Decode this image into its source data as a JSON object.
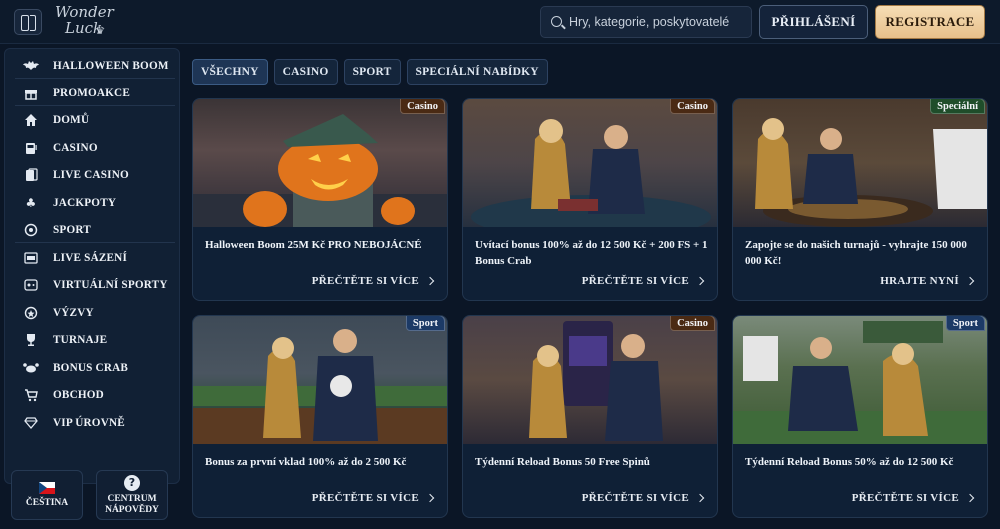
{
  "header": {
    "logo_text_1": "Wonder",
    "logo_text_2": "Luck",
    "search_placeholder": "Hry, kategorie, poskytovatelé",
    "login_label": "PŘIHLÁŠENÍ",
    "register_label": "REGISTRACE"
  },
  "sidebar": {
    "items": [
      {
        "label": "HALLOWEEN BOOM",
        "icon": "bat-icon"
      },
      {
        "label": "PROMOAKCE",
        "icon": "gift-icon"
      },
      {
        "label": "DOMŮ",
        "icon": "home-icon"
      },
      {
        "label": "CASINO",
        "icon": "slot-machine-icon"
      },
      {
        "label": "LIVE CASINO",
        "icon": "cards-icon"
      },
      {
        "label": "JACKPOTY",
        "icon": "clover-icon"
      },
      {
        "label": "SPORT",
        "icon": "ball-icon"
      },
      {
        "label": "LIVE SÁZENÍ",
        "icon": "live-icon"
      },
      {
        "label": "VIRTUÁLNÍ SPORTY",
        "icon": "controller-icon"
      },
      {
        "label": "VÝZVY",
        "icon": "badge-icon"
      },
      {
        "label": "TURNAJE",
        "icon": "trophy-icon"
      },
      {
        "label": "BONUS CRAB",
        "icon": "crab-icon"
      },
      {
        "label": "OBCHOD",
        "icon": "cart-icon"
      },
      {
        "label": "VIP ÚROVNĚ",
        "icon": "diamond-icon"
      }
    ],
    "language_label": "ČEŠTINA",
    "help_label_1": "CENTRUM",
    "help_label_2": "NÁPOVĚDY"
  },
  "tabs": [
    {
      "label": "VŠECHNY",
      "active": true
    },
    {
      "label": "CASINO",
      "active": false
    },
    {
      "label": "SPORT",
      "active": false
    },
    {
      "label": "SPECIÁLNÍ NABÍDKY",
      "active": false
    }
  ],
  "cards": [
    {
      "badge": "Casino",
      "badge_color": "#4a2a14",
      "title": "Halloween Boom 25M Kč PRO NEBOJÁCNÉ",
      "action": "PŘEČTĚTE SI VÍCE"
    },
    {
      "badge": "Casino",
      "badge_color": "#4a2a14",
      "title": "Uvítací bonus 100% až do 12 500 Kč + 200 FS + 1 Bonus Crab",
      "action": "PŘEČTĚTE SI VÍCE"
    },
    {
      "badge": "Speciální",
      "badge_color": "#1f4d2a",
      "title": "Zapojte se do našich turnajů - vyhrajte 150 000 000 Kč!",
      "action": "HRAJTE NYNÍ"
    },
    {
      "badge": "Sport",
      "badge_color": "#1c3a66",
      "title": "Bonus za první vklad 100% až do 2 500 Kč",
      "action": "PŘEČTĚTE SI VÍCE"
    },
    {
      "badge": "Casino",
      "badge_color": "#4a2a14",
      "title": "Týdenní Reload Bonus 50 Free Spinů",
      "action": "PŘEČTĚTE SI VÍCE"
    },
    {
      "badge": "Sport",
      "badge_color": "#1c3a66",
      "title": "Týdenní Reload Bonus 50% až do 12 500 Kč",
      "action": "PŘEČTĚTE SI VÍCE"
    }
  ]
}
